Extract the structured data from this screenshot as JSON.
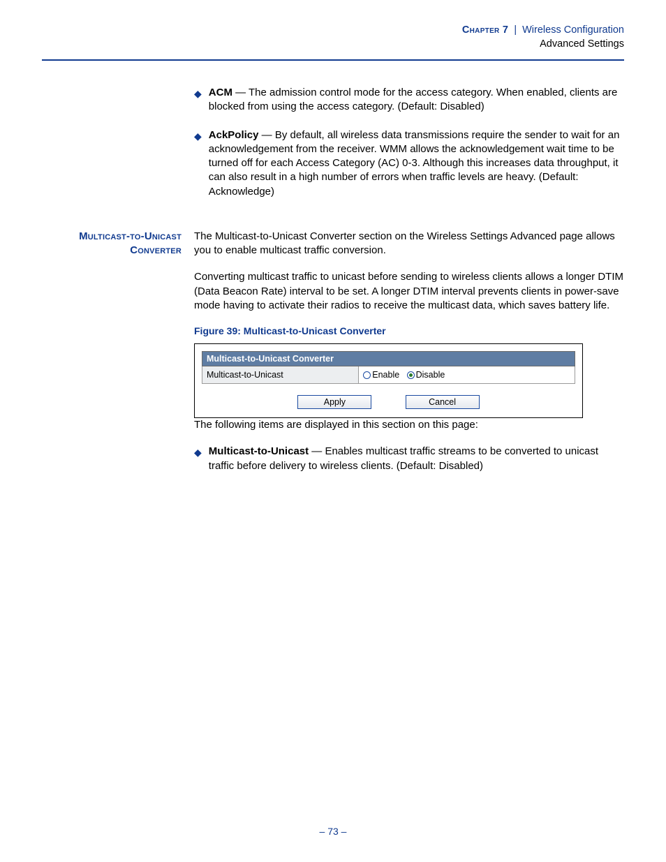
{
  "header": {
    "chapter": "Chapter 7",
    "sep": "|",
    "title": "Wireless Configuration",
    "subtitle": "Advanced Settings"
  },
  "bullets_top": [
    {
      "term": "ACM",
      "desc": " — The admission control mode for the access category. When enabled, clients are blocked from using the access category. (Default: Disabled)"
    },
    {
      "term": "AckPolicy",
      "desc": " — By default, all wireless data transmissions require the sender to wait for an acknowledgement from the receiver. WMM allows the acknowledgement wait time to be turned off for each Access Category (AC) 0-3. Although this increases data throughput, it can also result in a high number of errors when traffic levels are heavy. (Default: Acknowledge)"
    }
  ],
  "section": {
    "sidehead": "Multicast-to-Unicast Converter",
    "p1": "The Multicast-to-Unicast Converter section on the Wireless Settings Advanced page allows you to enable multicast traffic conversion.",
    "p2": "Converting multicast traffic to unicast before sending to wireless clients allows a longer DTIM (Data Beacon Rate) interval to be set. A longer DTIM interval prevents clients in power-save mode having to activate their radios to receive the multicast data, which saves battery life.",
    "fig_caption": "Figure 39:  Multicast-to-Unicast Converter",
    "ui": {
      "panel_title": "Multicast-to-Unicast Converter",
      "row_label": "Multicast-to-Unicast",
      "opt_enable": "Enable",
      "opt_disable": "Disable",
      "selected": "disable",
      "btn_apply": "Apply",
      "btn_cancel": "Cancel"
    },
    "after_fig_intro": "The following items are displayed in this section on this page:",
    "bullets_after": [
      {
        "term": "Multicast-to-Unicast",
        "desc": " — Enables multicast traffic streams to be converted to unicast traffic before delivery to wireless clients. (Default: Disabled)"
      }
    ]
  },
  "footer": "–  73  –"
}
